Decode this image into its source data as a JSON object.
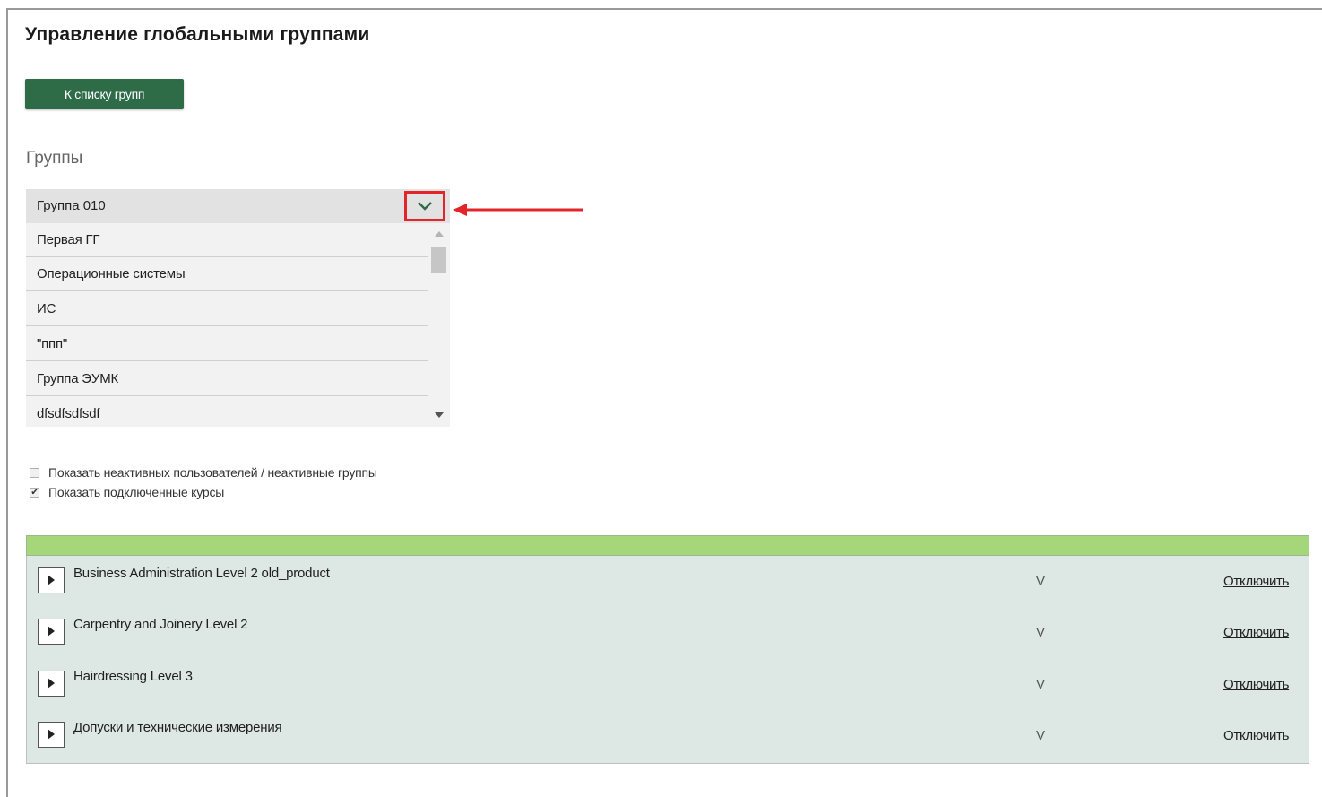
{
  "page": {
    "title": "Управление глобальными группами",
    "back_button": "К списку групп",
    "section_title": "Группы"
  },
  "dropdown": {
    "selected": "Группа 010",
    "options": [
      "Первая ГГ",
      "Операционные системы",
      "ИС",
      "\"ппп\"",
      "Группа ЭУМК",
      "dfsdfsdfsdf"
    ],
    "toggle_icon": "chevron-down-icon",
    "highlight_color": "#e3242b"
  },
  "filters": {
    "inactive": {
      "label": "Показать неактивных пользователей / неактивные группы",
      "checked": false
    },
    "courses": {
      "label": "Показать подключенные курсы",
      "checked": true
    }
  },
  "courses": [
    {
      "name": "Business Administration Level 2 old_product",
      "flag": "V",
      "action": "Отключить"
    },
    {
      "name": "Carpentry and Joinery Level 2",
      "flag": "V",
      "action": "Отключить"
    },
    {
      "name": "Hairdressing Level 3",
      "flag": "V",
      "action": "Отключить"
    },
    {
      "name": "Допуски и технические измерения",
      "flag": "V",
      "action": "Отключить"
    }
  ],
  "colors": {
    "button": "#2e6b47",
    "table_header": "#a5d67a",
    "table_body": "#dde7e3",
    "annotation": "#e3242b"
  }
}
